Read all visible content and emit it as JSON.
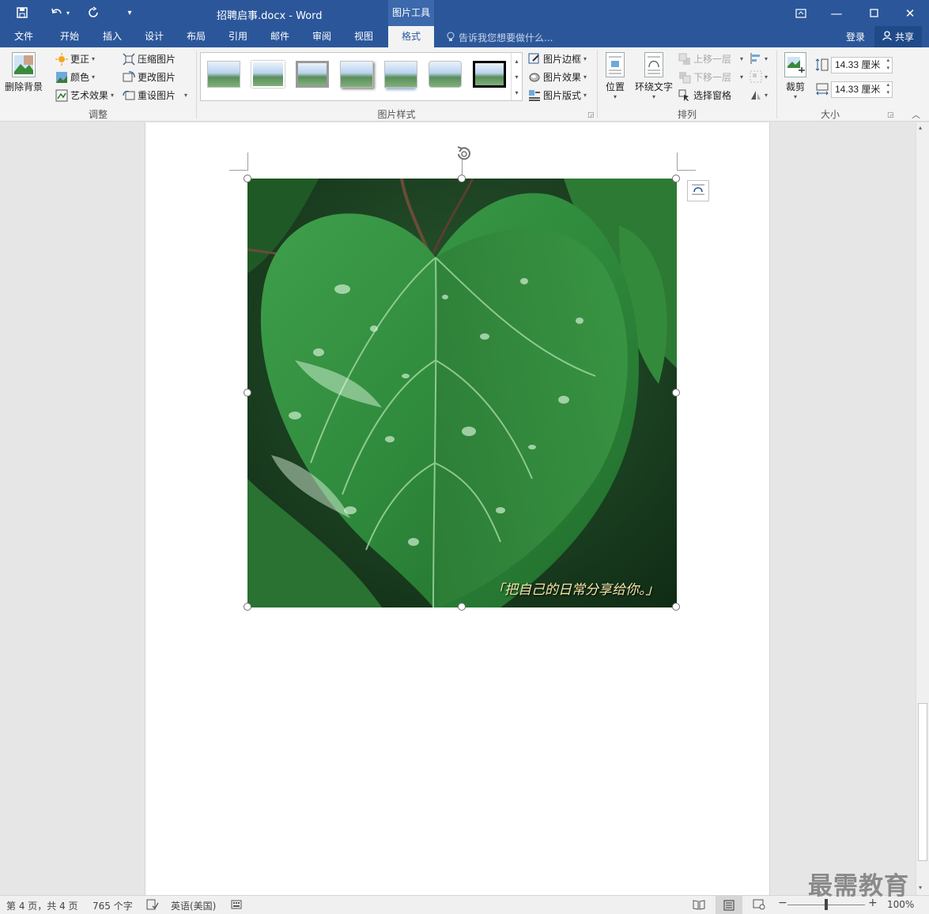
{
  "titlebar": {
    "document_title": "招聘启事.docx - Word",
    "context_tab_title": "图片工具",
    "bg": "#2b579a"
  },
  "tabs": [
    {
      "label": "文件"
    },
    {
      "label": "开始"
    },
    {
      "label": "插入"
    },
    {
      "label": "设计"
    },
    {
      "label": "布局"
    },
    {
      "label": "引用"
    },
    {
      "label": "邮件"
    },
    {
      "label": "审阅"
    },
    {
      "label": "视图"
    },
    {
      "label": "格式",
      "active": true
    }
  ],
  "tell_me": {
    "placeholder": "告诉我您想要做什么..."
  },
  "account": {
    "login": "登录",
    "share": "共享"
  },
  "ribbon": {
    "adjust": {
      "remove_bg": "删除背景",
      "corrections": "更正",
      "color": "颜色",
      "artistic": "艺术效果",
      "compress": "压缩图片",
      "change": "更改图片",
      "reset": "重设图片",
      "label": "调整"
    },
    "styles": {
      "border": "图片边框",
      "effects": "图片效果",
      "layout": "图片版式",
      "label": "图片样式"
    },
    "arrange": {
      "position": "位置",
      "wrap": "环绕文字",
      "bring_forward": "上移一层",
      "send_backward": "下移一层",
      "selection_pane": "选择窗格",
      "label": "排列"
    },
    "size": {
      "crop": "裁剪",
      "height": "14.33 厘米",
      "width": "14.33 厘米",
      "label": "大小"
    }
  },
  "picture": {
    "caption": "「把自己的日常分享给你。」",
    "leaf_color": "#2f8a3c",
    "bg_color": "#1c3d22"
  },
  "statusbar": {
    "page": "第 4 页，共 4 页",
    "words": "765 个字",
    "language": "英语(美国)",
    "zoom_minus": "−",
    "zoom_plus": "+",
    "zoom": "100%",
    "zoom_level": 0.5
  },
  "watermark": "最需教育"
}
